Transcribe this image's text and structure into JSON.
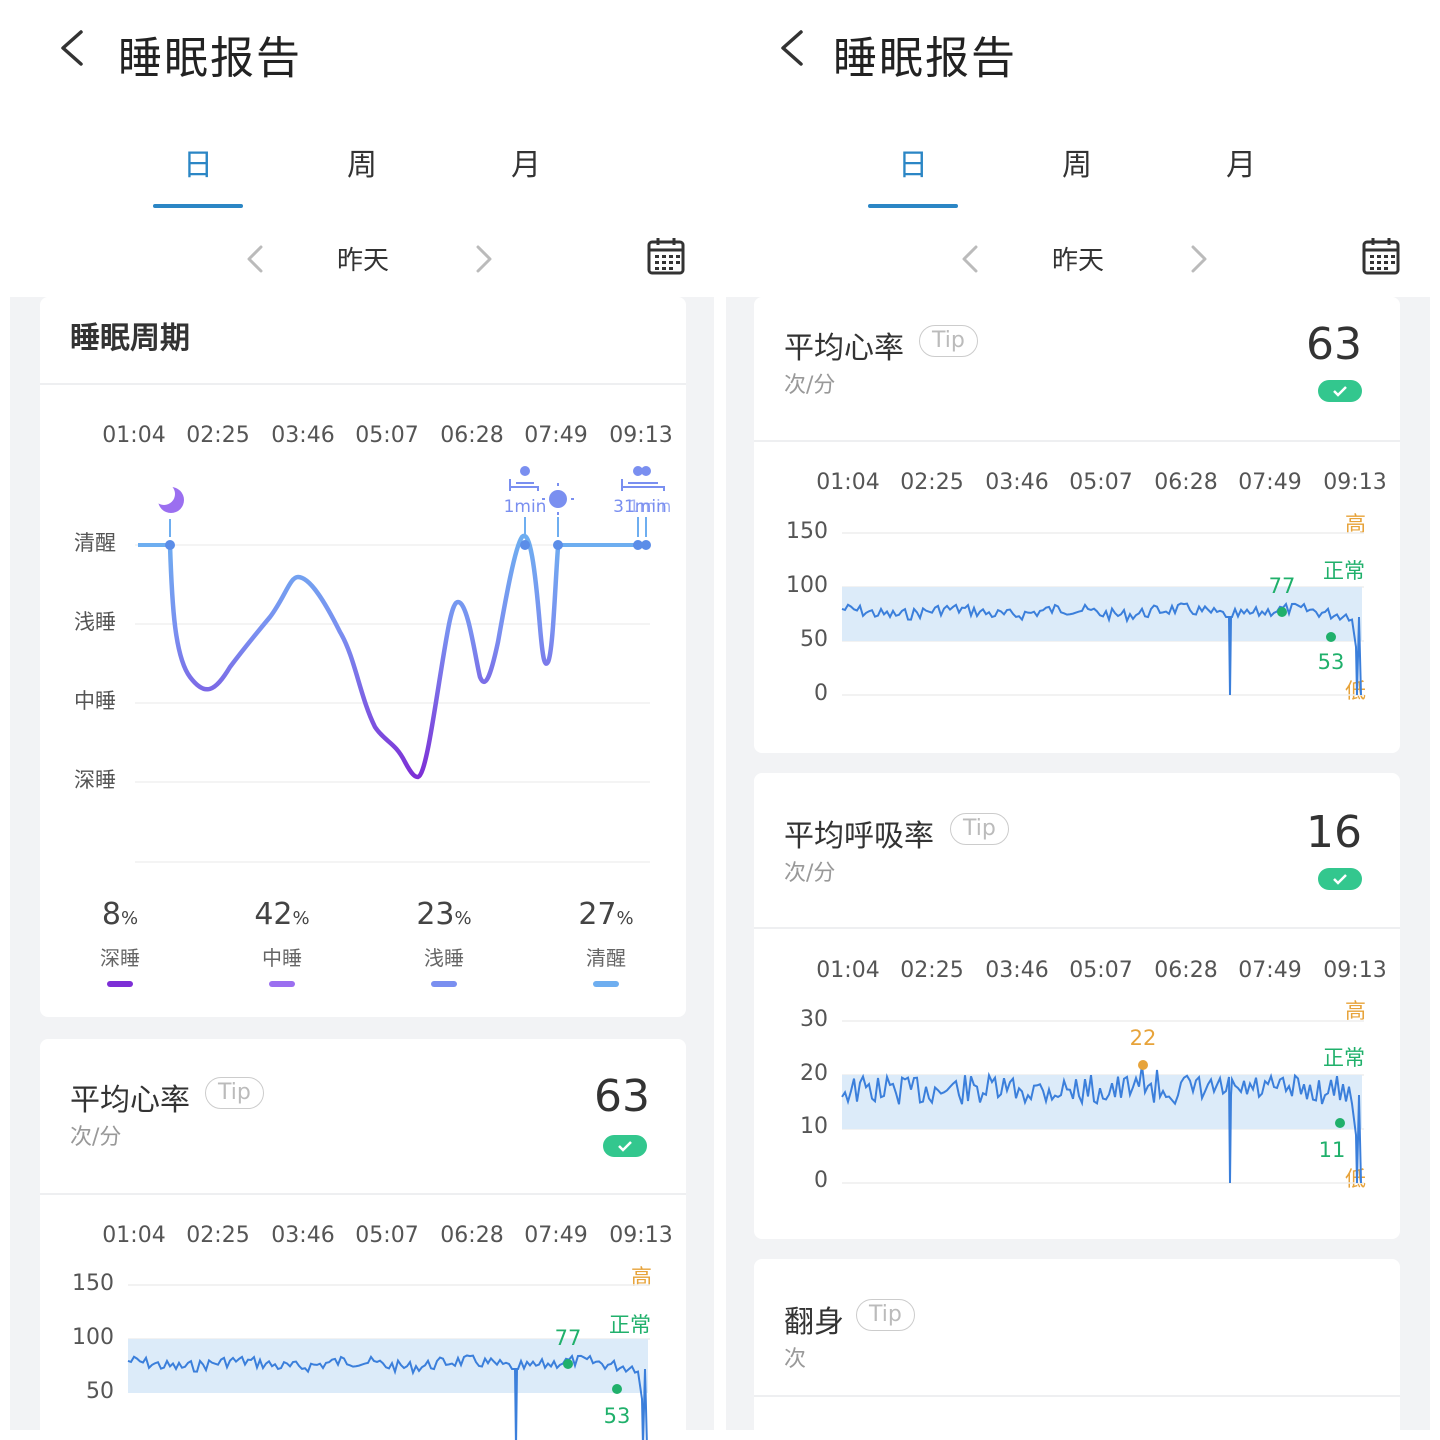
{
  "colors": {
    "accent": "#2b86c5",
    "high": "#e7a33a",
    "normal": "#20b06b",
    "deep": "#7d3fd9",
    "mid": "#9b6ff0",
    "light": "#7a8ff0",
    "awake": "#6eaef0",
    "hr_line": "#3b7fdb",
    "band": "#dcebf9"
  },
  "header": {
    "title": "睡眠报告",
    "back_icon": "chevron-left-icon"
  },
  "tabs": [
    {
      "label": "日",
      "active": true
    },
    {
      "label": "周",
      "active": false
    },
    {
      "label": "月",
      "active": false
    }
  ],
  "date_nav": {
    "label": "昨天",
    "prev_icon": "chevron-left-icon",
    "next_icon": "chevron-right-icon",
    "calendar_icon": "calendar-icon"
  },
  "times": [
    "01:04",
    "02:25",
    "03:46",
    "05:07",
    "06:28",
    "07:49",
    "09:13"
  ],
  "sleep_cycle": {
    "title": "睡眠周期",
    "stages": [
      "清醒",
      "浅睡",
      "中睡",
      "深睡"
    ],
    "markers": {
      "start_icon": "moon-icon",
      "end_icon": "sun-icon",
      "event1": "1min",
      "event2": "31min",
      "event3": "1min"
    },
    "summary": [
      {
        "value": "8",
        "unit": "%",
        "label": "深睡"
      },
      {
        "value": "42",
        "unit": "%",
        "label": "中睡"
      },
      {
        "value": "23",
        "unit": "%",
        "label": "浅睡"
      },
      {
        "value": "27",
        "unit": "%",
        "label": "清醒"
      }
    ]
  },
  "heart_rate": {
    "title": "平均心率",
    "tip": "Tip",
    "unit": "次/分",
    "value": "63",
    "yticks": [
      "150",
      "100",
      "50",
      "0"
    ],
    "levels": {
      "high": "高",
      "normal": "正常",
      "low": "低"
    },
    "max_label": "77",
    "min_label": "53"
  },
  "heart_rate_left": {
    "yticks": [
      "150",
      "100",
      "50"
    ]
  },
  "resp_rate": {
    "title": "平均呼吸率",
    "tip": "Tip",
    "unit": "次/分",
    "value": "16",
    "yticks": [
      "30",
      "20",
      "10",
      "0"
    ],
    "levels": {
      "high": "高",
      "normal": "正常",
      "low": "低"
    },
    "max_label": "22",
    "min_label": "11"
  },
  "turnover": {
    "title": "翻身",
    "tip": "Tip",
    "unit": "次"
  }
}
